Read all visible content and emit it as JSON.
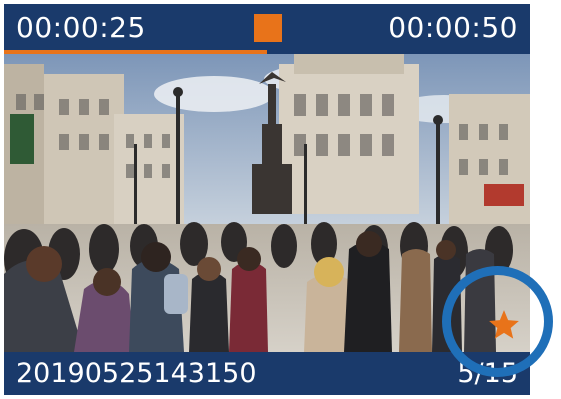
{
  "player": {
    "elapsed": "00:00:25",
    "total": "00:00:50",
    "progress": 0.5
  },
  "file": {
    "name": "20190525143150",
    "position": "5/15"
  },
  "icons": {
    "stop": "stop-icon",
    "favorite": "star-icon"
  },
  "colors": {
    "bar": "#1a3a6b",
    "accent": "#e8731a",
    "highlight": "#1f6fb8"
  }
}
